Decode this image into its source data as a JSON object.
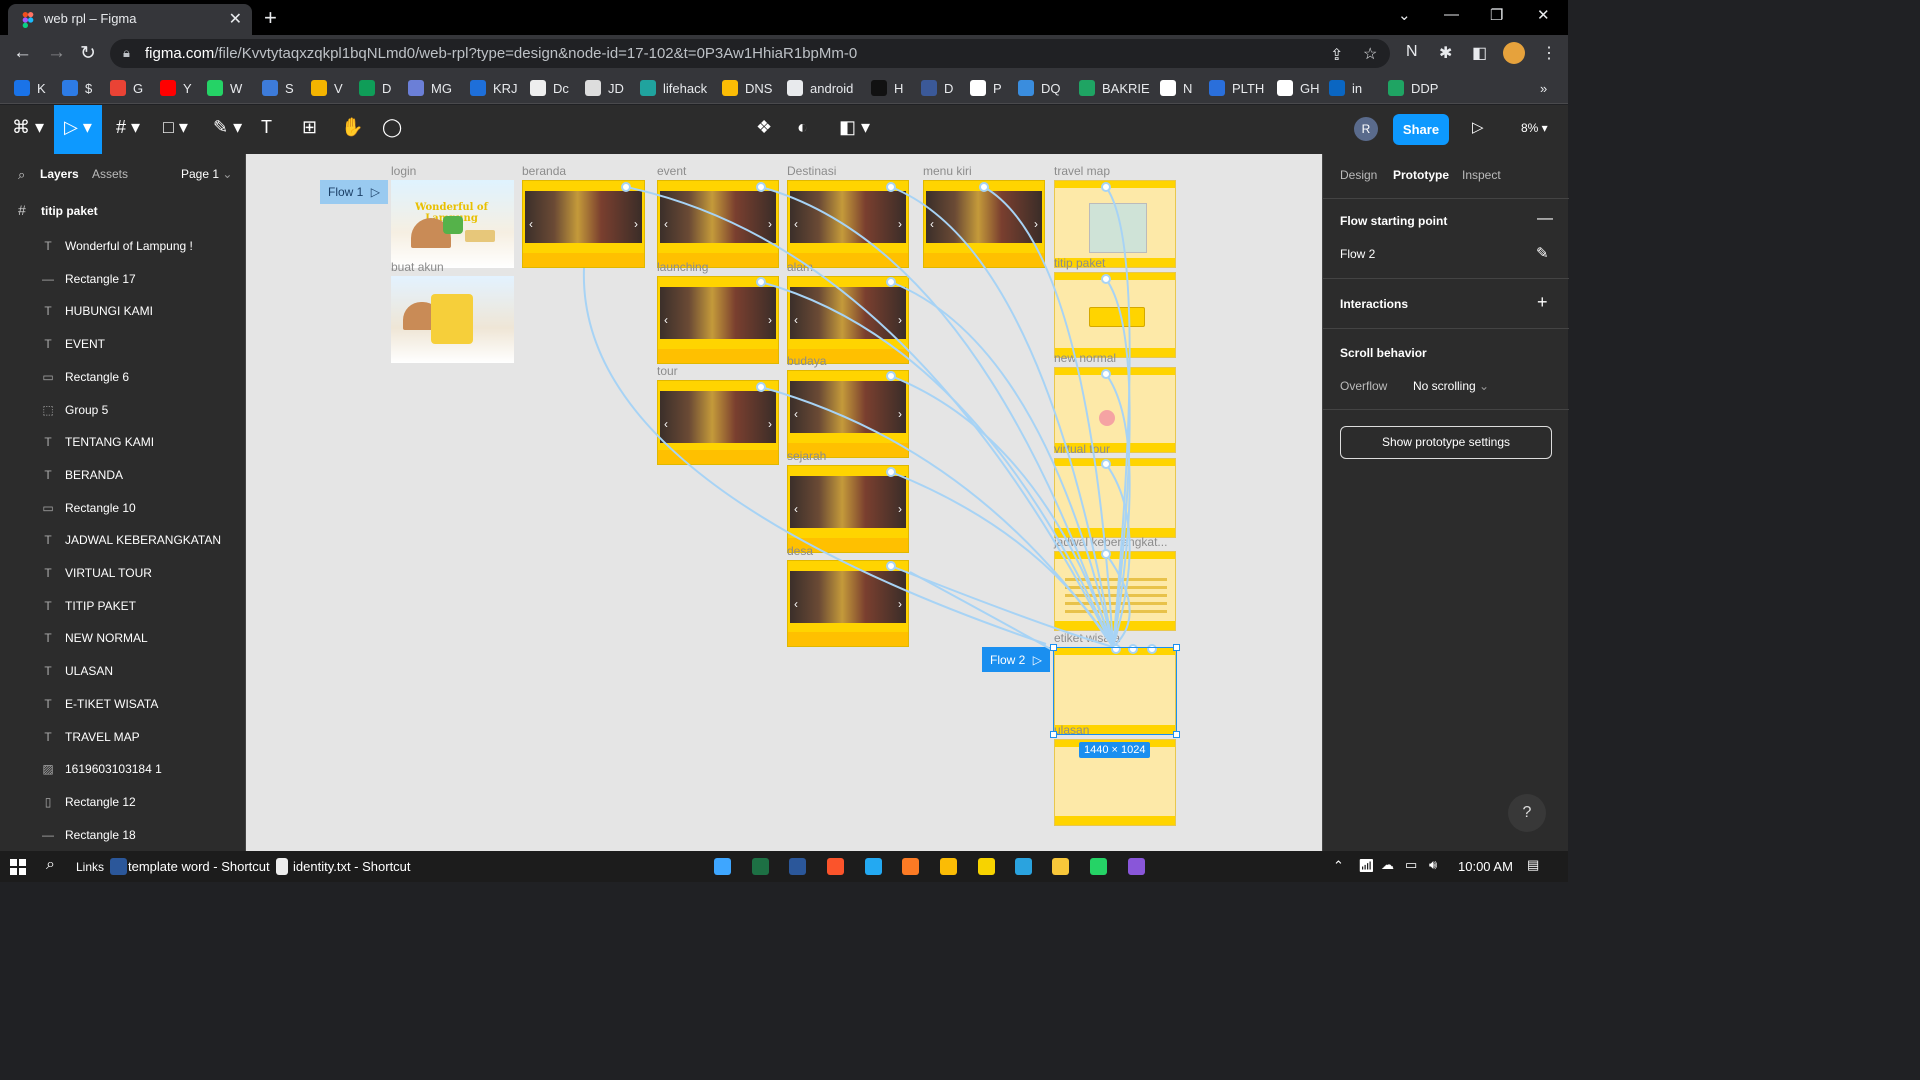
{
  "browser": {
    "tab_title": "web rpl – Figma",
    "close_glyph": "✕",
    "new_tab_glyph": "+",
    "window_controls": [
      "⌄",
      "—",
      "❐",
      "✕"
    ],
    "url_domain": "figma.com",
    "url_path": "/file/Kvvtytaqxzqkpl1bqNLmd0/web-rpl?type=design&node-id=17-102&t=0P3Aw1HhiaR1bpMm-0",
    "bookmarks": [
      {
        "label": "K",
        "color": "#1a73e8"
      },
      {
        "label": "$",
        "color": "#2d7be5"
      },
      {
        "label": "G",
        "color": "#ea4335"
      },
      {
        "label": "Y",
        "color": "#ff0000"
      },
      {
        "label": "W",
        "color": "#25d366"
      },
      {
        "label": "S",
        "color": "#3d7bd9"
      },
      {
        "label": "V",
        "color": "#f4b400"
      },
      {
        "label": "D",
        "color": "#0f9d58"
      },
      {
        "label": "MG",
        "color": "#6b7fd7"
      },
      {
        "label": "KRJ",
        "color": "#1e6fd9"
      },
      {
        "label": "Dc",
        "color": "#eeeeee"
      },
      {
        "label": "JD",
        "color": "#dddddd"
      },
      {
        "label": "lifehack",
        "color": "#20a39e"
      },
      {
        "label": "DNS",
        "color": "#fbbc05"
      },
      {
        "label": "android",
        "color": "#e8eaed"
      },
      {
        "label": "H",
        "color": "#111111"
      },
      {
        "label": "D",
        "color": "#3b5998"
      },
      {
        "label": "P",
        "color": "#ffffff"
      },
      {
        "label": "DQ",
        "color": "#3a8dde"
      },
      {
        "label": "BAKRIE",
        "color": "#1fa463"
      },
      {
        "label": "N",
        "color": "#ffffff"
      },
      {
        "label": "PLTH",
        "color": "#2a6fdb"
      },
      {
        "label": "GH",
        "color": "#ffffff"
      },
      {
        "label": "in",
        "color": "#0a66c2"
      },
      {
        "label": "DDP",
        "color": "#1fa463"
      }
    ],
    "bookmarks_more": "»"
  },
  "figma": {
    "toolbar": {
      "menu_icon": "figma-menu",
      "move_icon": "▷",
      "frame_icon": "#",
      "shape_icon": "□",
      "pen_icon": "✎",
      "text_icon": "T",
      "resources_icon": "⊞",
      "hand_icon": "✋",
      "comment_icon": "◯",
      "component_icon": "❖",
      "contrast_icon": "◐",
      "boolean_icon": "◧",
      "avatar_letter": "R",
      "share_label": "Share",
      "present_icon": "▷",
      "zoom": "8%"
    },
    "left_panel": {
      "tabs": [
        "Layers",
        "Assets"
      ],
      "page": "Page 1",
      "frame_name": "titip paket",
      "layers": [
        {
          "name": "Wonderful of Lampung !",
          "icon": "T"
        },
        {
          "name": "Rectangle 17",
          "icon": "—"
        },
        {
          "name": "HUBUNGI KAMI",
          "icon": "T"
        },
        {
          "name": "EVENT",
          "icon": "T"
        },
        {
          "name": "Rectangle 6",
          "icon": "▭"
        },
        {
          "name": "Group 5",
          "icon": "⬚"
        },
        {
          "name": "TENTANG KAMI",
          "icon": "T"
        },
        {
          "name": "BERANDA",
          "icon": "T"
        },
        {
          "name": "Rectangle 10",
          "icon": "▭"
        },
        {
          "name": "JADWAL KEBERANGKATAN",
          "icon": "T"
        },
        {
          "name": "VIRTUAL TOUR",
          "icon": "T"
        },
        {
          "name": "TITIP PAKET",
          "icon": "T"
        },
        {
          "name": "NEW NORMAL",
          "icon": "T"
        },
        {
          "name": "ULASAN",
          "icon": "T"
        },
        {
          "name": "E-TIKET WISATA",
          "icon": "T"
        },
        {
          "name": "TRAVEL MAP",
          "icon": "T"
        },
        {
          "name": "1619603103184 1",
          "icon": "▨"
        },
        {
          "name": "Rectangle 12",
          "icon": "▯"
        },
        {
          "name": "Rectangle 18",
          "icon": "—"
        }
      ]
    },
    "canvas": {
      "frame_labels": {
        "login": "login",
        "buat_akun": "buat akun",
        "beranda": "beranda",
        "event": "event",
        "launching": "launching",
        "tour": "tour",
        "destinasi": "Destinasi",
        "alam": "alam",
        "budaya": "budaya",
        "sejarah": "sejarah",
        "desa": "desa",
        "menu_kiri": "menu kiri",
        "travel_map": "travel map",
        "titip_paket": "titip paket",
        "new_normal": "new normal",
        "virtual_tour": "virtual tour",
        "jadwal": "jadwal keberangkat...",
        "etiket": "etiket wisata",
        "ulasan": "ulasan"
      },
      "login_heading": "Wonderful of Lampung",
      "flow1": "Flow 1",
      "flow2": "Flow 2",
      "selection_size": "1440 × 1024",
      "carousel_left": "‹",
      "carousel_right": "›",
      "flow_play": "▷",
      "colors": {
        "accent": "#ffd400",
        "pale": "#fde9a8",
        "connector": "#a7d3f5",
        "selection": "#1a8ff0"
      }
    },
    "right_panel": {
      "tabs": [
        "Design",
        "Prototype",
        "Inspect"
      ],
      "active_tab": "Prototype",
      "flow_start_heading": "Flow starting point",
      "flow_name": "Flow 2",
      "interactions_heading": "Interactions",
      "scroll_heading": "Scroll behavior",
      "overflow_label": "Overflow",
      "overflow_value": "No scrolling",
      "settings_button": "Show prototype settings",
      "help": "?"
    }
  },
  "taskbar": {
    "links_label": "Links",
    "shortcut1": "template word - Shortcut",
    "shortcut2": "identity.txt - Shortcut",
    "time": "10:00 AM",
    "apps": [
      {
        "name": "app-1",
        "color": "#3ea6ff"
      },
      {
        "name": "excel",
        "color": "#1d7044"
      },
      {
        "name": "word",
        "color": "#2b579a"
      },
      {
        "name": "brave",
        "color": "#fb542b"
      },
      {
        "name": "vscode",
        "color": "#23a9f2"
      },
      {
        "name": "xampp",
        "color": "#fb7a24"
      },
      {
        "name": "chrome",
        "color": "#fbbc05"
      },
      {
        "name": "sticky-notes",
        "color": "#f7d300"
      },
      {
        "name": "telegram",
        "color": "#2aa3df"
      },
      {
        "name": "file-explorer",
        "color": "#f8c73a"
      },
      {
        "name": "whatsapp",
        "color": "#25d366"
      },
      {
        "name": "github-desktop",
        "color": "#8956d9"
      }
    ]
  }
}
